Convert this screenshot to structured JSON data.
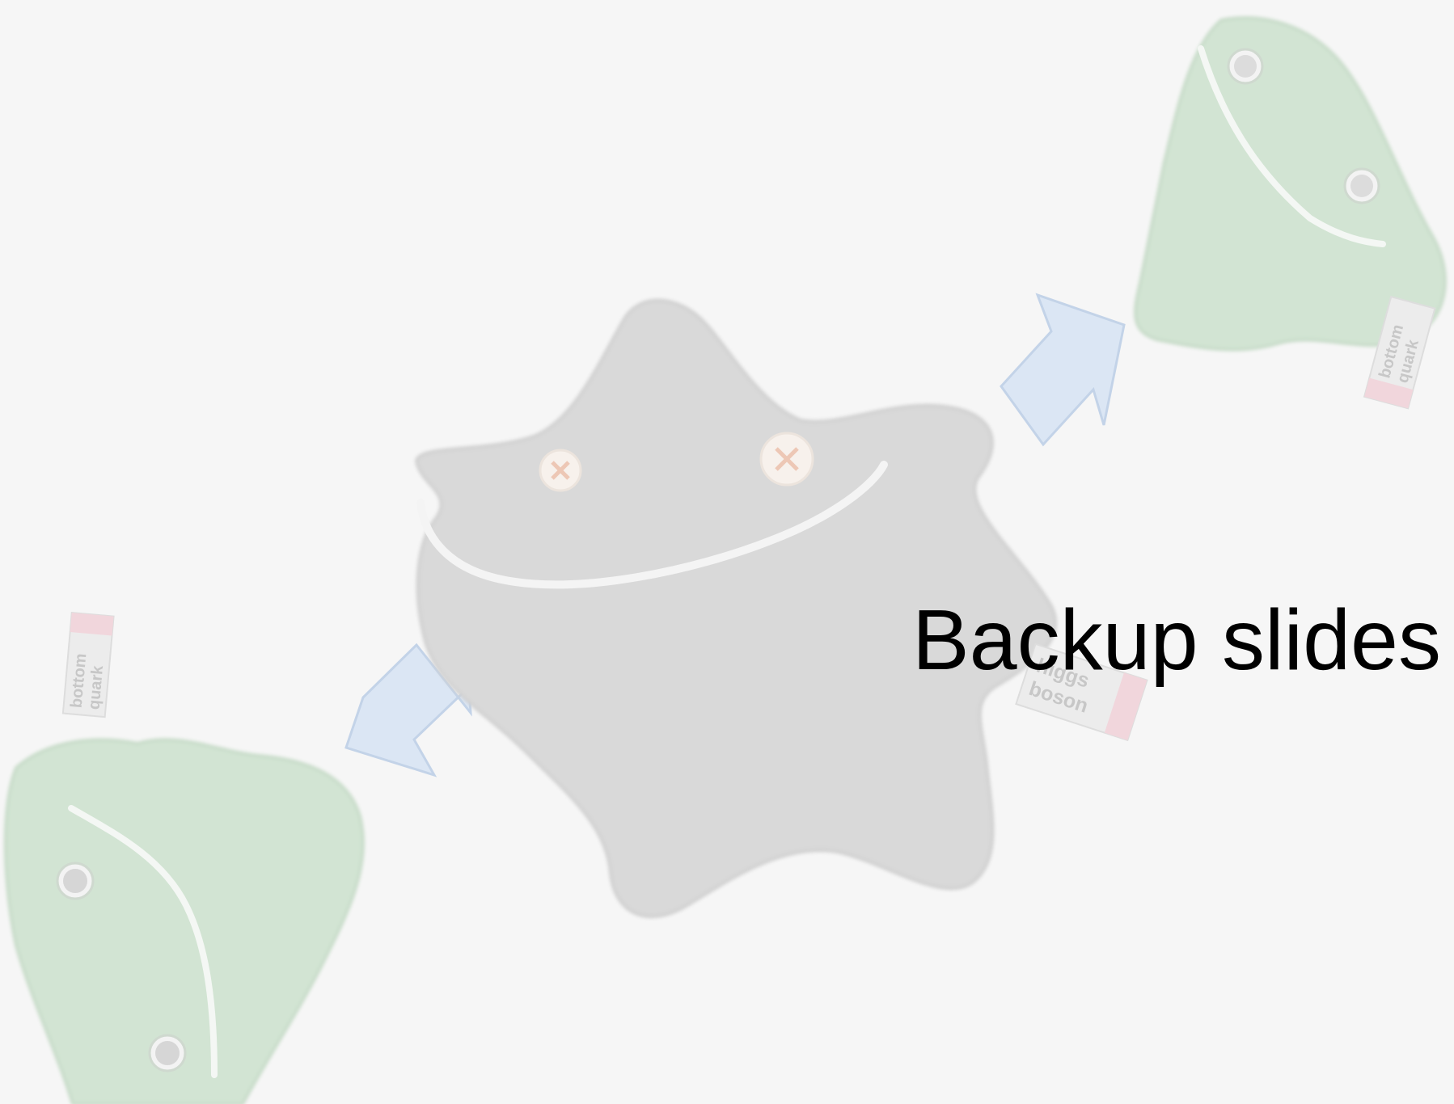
{
  "slide": {
    "title": "Backup slides"
  },
  "illustration": {
    "central_particle": {
      "label_line1": "higgs",
      "label_line2": "boson",
      "body_color": "#d9d9d9"
    },
    "particle_top_right": {
      "label_line1": "bottom",
      "label_line2": "quark",
      "body_color": "#d2e4d3"
    },
    "particle_bottom_left": {
      "label_line1": "bottom",
      "label_line2": "quark",
      "body_color": "#d2e4d3"
    },
    "arrow_color": "#dbe6f4"
  }
}
